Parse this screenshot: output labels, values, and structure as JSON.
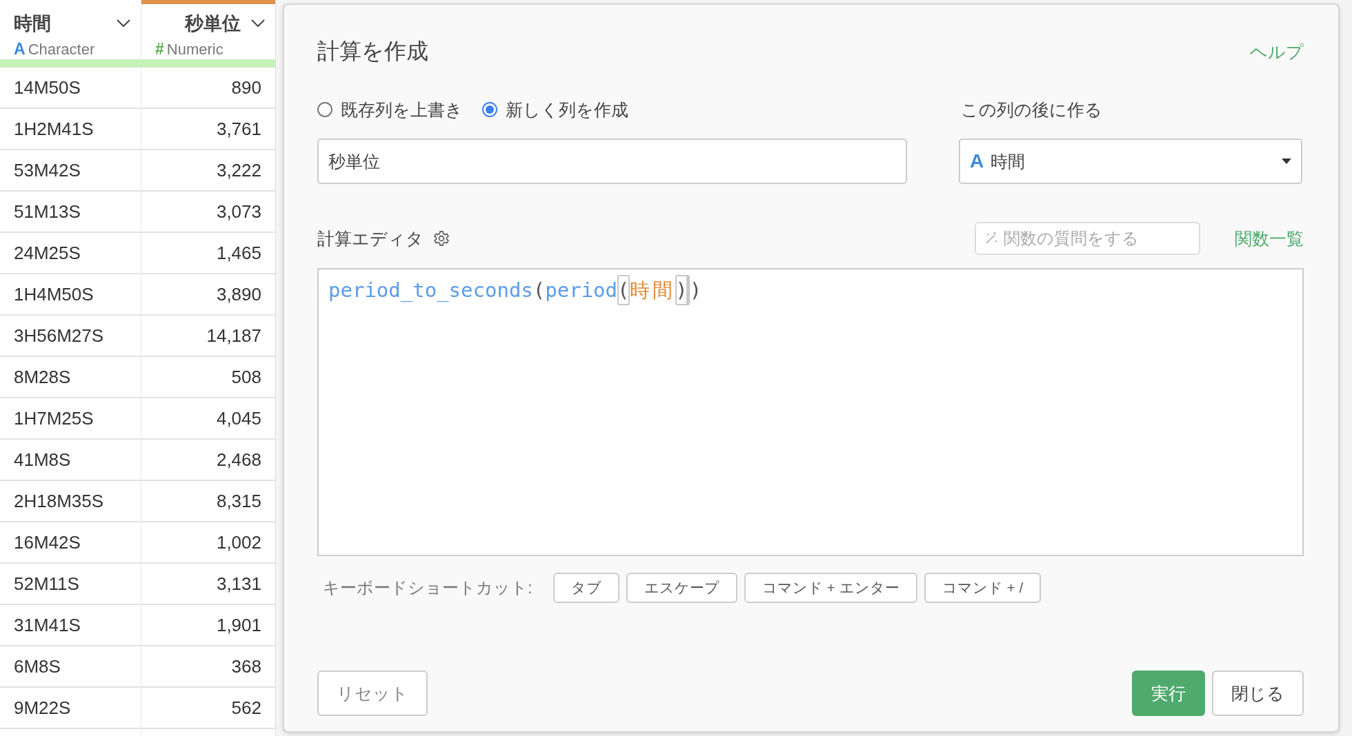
{
  "table": {
    "columns": [
      {
        "name": "時間",
        "kind": "character",
        "type_icon": "A",
        "type": "Character",
        "selected": false
      },
      {
        "name": "秒単位",
        "kind": "numeric",
        "type_icon": "#",
        "type": "Numeric",
        "selected": true
      }
    ],
    "rows": [
      [
        "14M50S",
        "890"
      ],
      [
        "1H2M41S",
        "3,761"
      ],
      [
        "53M42S",
        "3,222"
      ],
      [
        "51M13S",
        "3,073"
      ],
      [
        "24M25S",
        "1,465"
      ],
      [
        "1H4M50S",
        "3,890"
      ],
      [
        "3H56M27S",
        "14,187"
      ],
      [
        "8M28S",
        "508"
      ],
      [
        "1H7M25S",
        "4,045"
      ],
      [
        "41M8S",
        "2,468"
      ],
      [
        "2H18M35S",
        "8,315"
      ],
      [
        "16M42S",
        "1,002"
      ],
      [
        "52M11S",
        "3,131"
      ],
      [
        "31M41S",
        "1,901"
      ],
      [
        "6M8S",
        "368"
      ],
      [
        "9M22S",
        "562"
      ]
    ]
  },
  "dialog": {
    "title": "計算を作成",
    "help_link": "ヘルプ",
    "mode_options": [
      {
        "label": "既存列を上書き",
        "selected": false
      },
      {
        "label": "新しく列を作成",
        "selected": true
      }
    ],
    "column_name_field": {
      "value": "秒単位"
    },
    "position_label": "この列の後に作る",
    "position_select": {
      "type_icon": "A",
      "value": "時間"
    },
    "editor_label": "計算エディタ",
    "ask_field": {
      "placeholder": "関数の質問をする"
    },
    "function_list_link": "関数一覧",
    "code": [
      {
        "text": "period_to_seconds",
        "kind": "function",
        "matched": false,
        "cursor_after": false
      },
      {
        "text": "(",
        "kind": "paren",
        "matched": false,
        "cursor_after": false
      },
      {
        "text": "period",
        "kind": "function",
        "matched": false,
        "cursor_after": false
      },
      {
        "text": "(",
        "kind": "paren",
        "matched": true,
        "cursor_after": false
      },
      {
        "text": "時間",
        "kind": "column",
        "matched": false,
        "cursor_after": false
      },
      {
        "text": ")",
        "kind": "paren",
        "matched": true,
        "cursor_after": true
      },
      {
        "text": ")",
        "kind": "paren",
        "matched": false,
        "cursor_after": false
      }
    ],
    "shortcuts_label": "キーボードショートカット:",
    "shortcuts": [
      "タブ",
      "エスケープ",
      "コマンド + エンター",
      "コマンド + /"
    ],
    "buttons": [
      {
        "label": "リセット",
        "kind": "secondary"
      },
      {
        "label": "実行",
        "kind": "primary"
      },
      {
        "label": "閉じる",
        "kind": "secondary"
      }
    ]
  }
}
